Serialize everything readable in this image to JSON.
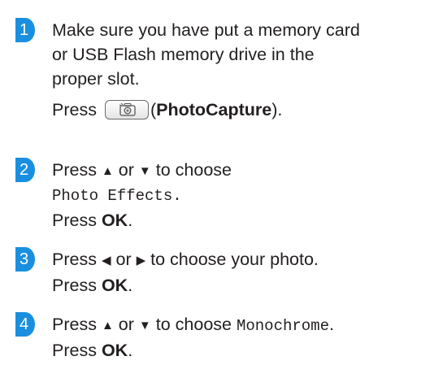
{
  "steps": [
    {
      "number": "1",
      "line1": "Make sure you have put a memory card",
      "line2": "or USB Flash memory drive in the",
      "line3": "proper slot.",
      "press": "Press",
      "button_icon": "camera-icon",
      "paren_open": "(",
      "button_name": "PhotoCapture",
      "paren_close": ")."
    },
    {
      "number": "2",
      "press": "Press",
      "up_arrow": "▲",
      "or": "or",
      "down_arrow": "▼",
      "to_choose": "to choose",
      "option": "Photo Effects.",
      "press2": "Press",
      "ok": "OK",
      "period": "."
    },
    {
      "number": "3",
      "press": "Press",
      "left_arrow": "◀",
      "or": "or",
      "right_arrow": "▶",
      "text": "to choose your photo.",
      "press2": "Press",
      "ok": "OK",
      "period": "."
    },
    {
      "number": "4",
      "press": "Press",
      "up_arrow": "▲",
      "or": "or",
      "down_arrow": "▼",
      "to_choose": "to choose",
      "option": "Monochrome",
      "option_period": ".",
      "press2": "Press",
      "ok": "OK",
      "period": "."
    }
  ],
  "colors": {
    "badge": "#1a8fe0",
    "text": "#231f20"
  }
}
